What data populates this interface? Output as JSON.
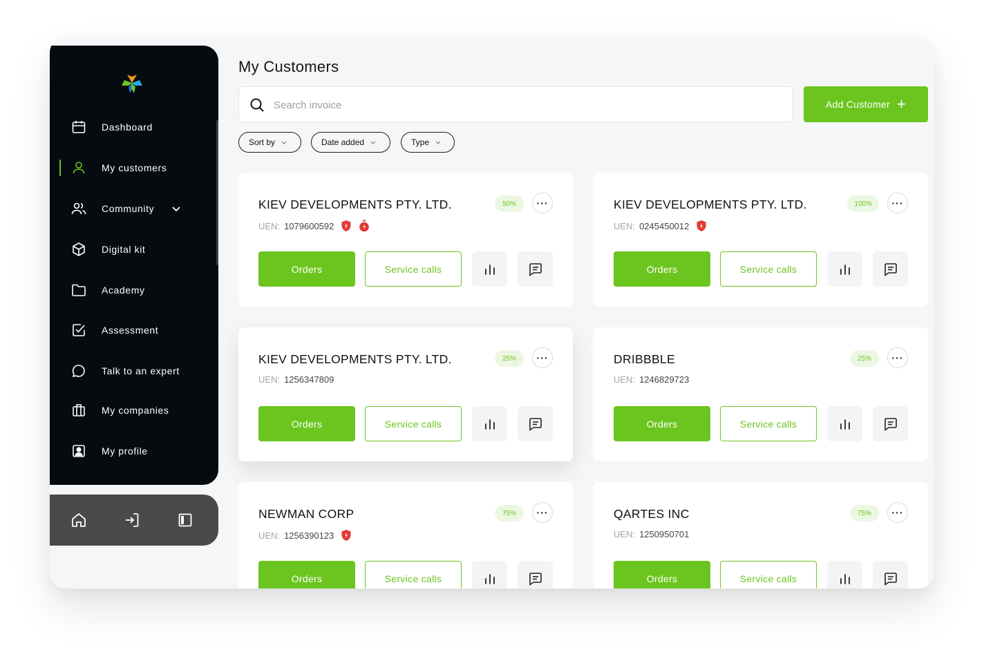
{
  "sidebar": {
    "items": [
      {
        "label": "Dashboard",
        "icon": "calendar-icon"
      },
      {
        "label": "My customers",
        "icon": "user-icon",
        "active": true
      },
      {
        "label": "Community",
        "icon": "users-icon"
      },
      {
        "label": "Digital kit",
        "icon": "cube-icon"
      },
      {
        "label": "Academy",
        "icon": "folder-icon"
      },
      {
        "label": "Assessment",
        "icon": "checkbox-icon"
      },
      {
        "label": "Talk to an expert",
        "icon": "chat-bubble-icon"
      },
      {
        "label": "My companies",
        "icon": "building-icon"
      },
      {
        "label": "My profile",
        "icon": "profile-card-icon"
      }
    ],
    "bottom": [
      "home-icon",
      "login-icon",
      "panel-icon"
    ]
  },
  "main": {
    "title": "My Customers",
    "search_placeholder": "Search invoice",
    "add_button": "Add Customer",
    "filters": [
      "Sort by",
      "Date added",
      "Type"
    ]
  },
  "uen_label": "UEN:",
  "cards": [
    {
      "name": "KIEV DEVELOPMENTS PTY. LTD.",
      "uen": "1079600592",
      "progress": "50%",
      "badges": 2,
      "orders": "Orders",
      "service": "Service calls"
    },
    {
      "name": "KIEV DEVELOPMENTS PTY. LTD.",
      "uen": "0245450012",
      "progress": "100%",
      "badges": 1,
      "orders": "Orders",
      "service": "Service calls"
    },
    {
      "name": "KIEV DEVELOPMENTS PTY. LTD.",
      "uen": "1256347809",
      "progress": "25%",
      "badges": 0,
      "orders": "Orders",
      "service": "Service calls"
    },
    {
      "name": "DRIBBBLE",
      "uen": "1246829723",
      "progress": "25%",
      "badges": 0,
      "orders": "Orders",
      "service": "Service calls"
    },
    {
      "name": "NEWMAN CORP",
      "uen": "1256390123",
      "progress": "75%",
      "badges": 1,
      "orders": "Orders",
      "service": "Service calls"
    },
    {
      "name": "QARTES INC",
      "uen": "1250950701",
      "progress": "75%",
      "badges": 0,
      "orders": "Orders",
      "service": "Service calls"
    }
  ],
  "colors": {
    "accent": "#6cc51f",
    "sidebar": "#060b10",
    "badge_red": "#e53935"
  }
}
